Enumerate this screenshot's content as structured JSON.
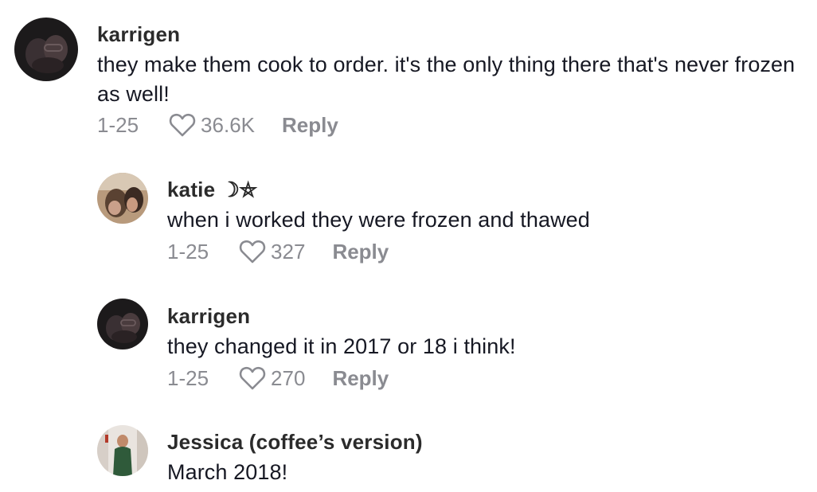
{
  "comments": [
    {
      "username": "karrigen",
      "text": "they make them cook to order. it's the only thing there that's never frozen as well!",
      "date": "1-25",
      "likes": "36.6K",
      "reply_label": "Reply"
    },
    {
      "username": "katie ☽⛤",
      "text": "when i worked they were frozen and thawed",
      "date": "1-25",
      "likes": "327",
      "reply_label": "Reply"
    },
    {
      "username": "karrigen",
      "text": "they changed it in 2017 or 18 i think!",
      "date": "1-25",
      "likes": "270",
      "reply_label": "Reply"
    },
    {
      "username": "Jessica (coffee’s version)",
      "text": "March 2018!"
    }
  ],
  "colors": {
    "text": "#161823",
    "muted": "#8a8b91"
  },
  "icons": {
    "like": "heart-outline-icon"
  }
}
